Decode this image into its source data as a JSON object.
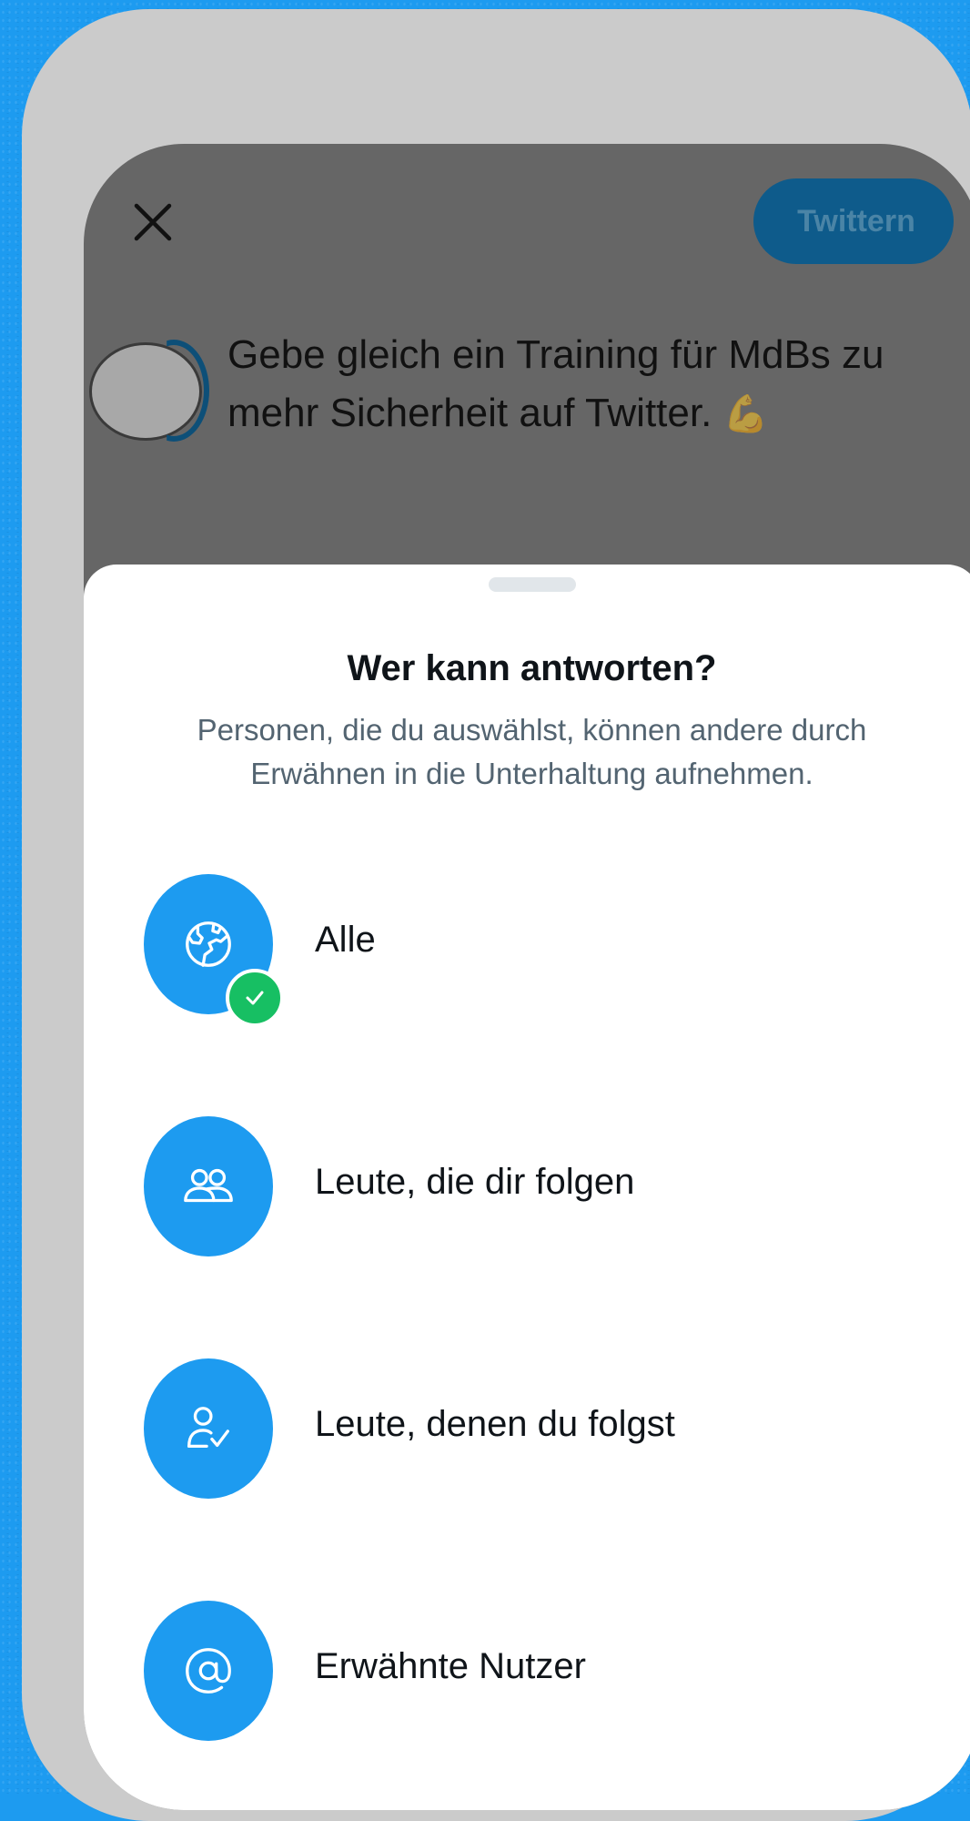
{
  "header": {
    "close_icon": "close-icon",
    "tweet_button_label": "Twittern"
  },
  "draft": {
    "text": "Gebe gleich ein Training für MdBs zu mehr Sicherheit auf Twitter.",
    "emoji": "💪"
  },
  "sheet": {
    "title": "Wer kann antworten?",
    "subtitle": "Personen, die du auswählst, können andere durch Erwähnen in die Unterhaltung aufnehmen.",
    "options": [
      {
        "label": "Alle",
        "icon": "globe-icon",
        "selected": true
      },
      {
        "label": "Leute, die dir folgen",
        "icon": "people-icon",
        "selected": false
      },
      {
        "label": "Leute, denen du folgst",
        "icon": "person-check-icon",
        "selected": false
      },
      {
        "label": "Erwähnte Nutzer",
        "icon": "at-icon",
        "selected": false
      }
    ]
  },
  "colors": {
    "background": "#1d9bf0",
    "accent": "#1d9bf0",
    "selected_check": "#17bf63",
    "dim_overlay": "#666666"
  }
}
